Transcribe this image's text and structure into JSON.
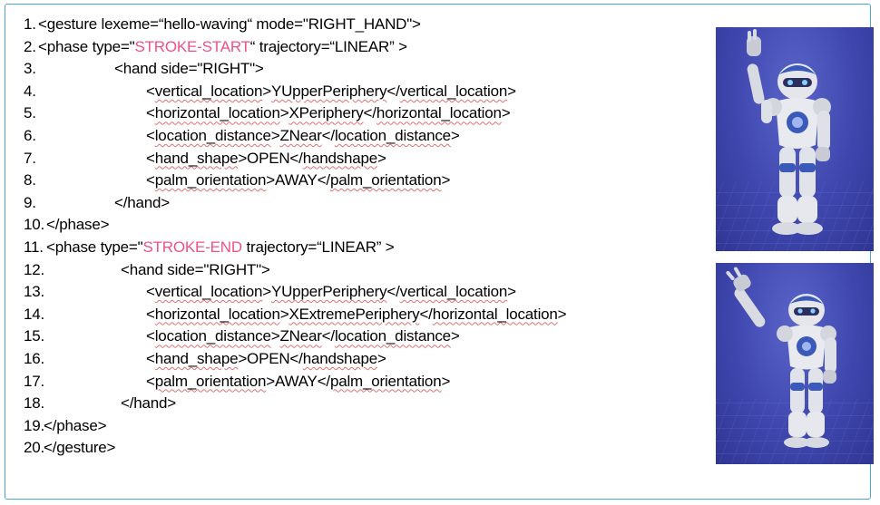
{
  "code_lines": [
    {
      "num": "1.",
      "indent": 0,
      "parts": [
        {
          "t": "<gesture lexeme=“hello-waving“ mode=\"RIGHT_HAND\">",
          "s": ""
        }
      ]
    },
    {
      "num": "2.",
      "indent": 0,
      "parts": [
        {
          "t": "<phase type=\"",
          "s": ""
        },
        {
          "t": "STROKE-START",
          "s": "red"
        },
        {
          "t": "“ trajectory=“LINEAR” >",
          "s": ""
        }
      ]
    },
    {
      "num": "3.",
      "indent": 100,
      "parts": [
        {
          "t": "<hand side=\"RIGHT\">",
          "s": ""
        }
      ]
    },
    {
      "num": "4.",
      "indent": 135,
      "parts": [
        {
          "t": "<",
          "s": ""
        },
        {
          "t": "vertical_location",
          "s": "sq"
        },
        {
          "t": ">",
          "s": ""
        },
        {
          "t": "YUpperPeriphery",
          "s": "sq"
        },
        {
          "t": "</",
          "s": ""
        },
        {
          "t": "vertical_location",
          "s": "sq"
        },
        {
          "t": ">",
          "s": ""
        }
      ]
    },
    {
      "num": "5.",
      "indent": 135,
      "parts": [
        {
          "t": "<",
          "s": ""
        },
        {
          "t": "horizontal_location",
          "s": "sq"
        },
        {
          "t": ">",
          "s": ""
        },
        {
          "t": "XPeriphery",
          "s": "sq"
        },
        {
          "t": "</",
          "s": ""
        },
        {
          "t": "horizontal_location",
          "s": "sq"
        },
        {
          "t": ">",
          "s": ""
        }
      ]
    },
    {
      "num": "6.",
      "indent": 135,
      "parts": [
        {
          "t": "<",
          "s": ""
        },
        {
          "t": "location_distance",
          "s": "sq"
        },
        {
          "t": ">",
          "s": ""
        },
        {
          "t": "ZNear",
          "s": "sq"
        },
        {
          "t": "</",
          "s": ""
        },
        {
          "t": "location_distance",
          "s": "sq"
        },
        {
          "t": ">",
          "s": ""
        }
      ]
    },
    {
      "num": "7.",
      "indent": 135,
      "parts": [
        {
          "t": "<",
          "s": ""
        },
        {
          "t": "hand_shape",
          "s": "sq"
        },
        {
          "t": ">OPEN</",
          "s": ""
        },
        {
          "t": "handshape",
          "s": "sq"
        },
        {
          "t": ">",
          "s": ""
        }
      ]
    },
    {
      "num": "8.",
      "indent": 135,
      "parts": [
        {
          "t": "<",
          "s": ""
        },
        {
          "t": "palm_orientation",
          "s": "sq"
        },
        {
          "t": ">AWAY</",
          "s": ""
        },
        {
          "t": "palm_orientation",
          "s": "sq"
        },
        {
          "t": ">",
          "s": ""
        }
      ]
    },
    {
      "num": "9.",
      "indent": 100,
      "parts": [
        {
          "t": "</hand>",
          "s": ""
        }
      ]
    },
    {
      "num": "10.",
      "indent": 0,
      "parts": [
        {
          "t": "</phase>",
          "s": ""
        }
      ]
    },
    {
      "num": "11.",
      "indent": 0,
      "parts": [
        {
          "t": "<phase type=\"",
          "s": ""
        },
        {
          "t": "STROKE-END",
          "s": "red"
        },
        {
          "t": " trajectory=“LINEAR” >",
          "s": ""
        }
      ]
    },
    {
      "num": "12.",
      "indent": 107,
      "parts": [
        {
          "t": "<hand side=\"RIGHT\">",
          "s": ""
        }
      ]
    },
    {
      "num": "13.",
      "indent": 135,
      "parts": [
        {
          "t": "<",
          "s": ""
        },
        {
          "t": "vertical_location",
          "s": "sq"
        },
        {
          "t": ">",
          "s": ""
        },
        {
          "t": "YUpperPeriphery",
          "s": "sq"
        },
        {
          "t": "</",
          "s": ""
        },
        {
          "t": "vertical_location",
          "s": "sq"
        },
        {
          "t": ">",
          "s": ""
        }
      ]
    },
    {
      "num": "14.",
      "indent": 135,
      "parts": [
        {
          "t": "<",
          "s": ""
        },
        {
          "t": "horizontal_location",
          "s": "sq"
        },
        {
          "t": ">",
          "s": ""
        },
        {
          "t": "XExtremePeriphery",
          "s": "sq"
        },
        {
          "t": "</",
          "s": ""
        },
        {
          "t": "horizontal_location",
          "s": "sq"
        },
        {
          "t": ">",
          "s": ""
        }
      ]
    },
    {
      "num": "15.",
      "indent": 135,
      "parts": [
        {
          "t": "<",
          "s": ""
        },
        {
          "t": "location_distance",
          "s": "sq"
        },
        {
          "t": ">",
          "s": ""
        },
        {
          "t": "ZNear",
          "s": "sq"
        },
        {
          "t": "</",
          "s": ""
        },
        {
          "t": "location_distance",
          "s": "sq"
        },
        {
          "t": ">",
          "s": ""
        }
      ]
    },
    {
      "num": "16.",
      "indent": 135,
      "parts": [
        {
          "t": "<",
          "s": ""
        },
        {
          "t": "hand_shape",
          "s": "sq"
        },
        {
          "t": ">OPEN</",
          "s": ""
        },
        {
          "t": "handshape",
          "s": "sq"
        },
        {
          "t": ">",
          "s": ""
        }
      ]
    },
    {
      "num": "17.",
      "indent": 135,
      "parts": [
        {
          "t": "<",
          "s": ""
        },
        {
          "t": "palm_orientation",
          "s": "sq"
        },
        {
          "t": ">AWAY</",
          "s": ""
        },
        {
          "t": "palm_orientation",
          "s": "sq"
        },
        {
          "t": ">",
          "s": ""
        }
      ]
    },
    {
      "num": "18.",
      "indent": 107,
      "parts": [
        {
          "t": "</hand>",
          "s": ""
        }
      ]
    },
    {
      "num": "19.",
      "indent": 0,
      "parts": [
        {
          "t": "</phase>",
          "s": ""
        }
      ]
    },
    {
      "num": "20.",
      "indent": 0,
      "parts": [
        {
          "t": "</gesture>",
          "s": ""
        }
      ]
    }
  ],
  "colors": {
    "frame_border": "#49a6cf",
    "keyword_red": "#f0508a",
    "spell_squiggle": "#e07070",
    "robot_background": "#3f47ae"
  },
  "images": [
    {
      "name": "robot-image-stroke-start",
      "depicts": "humanoid robot waving right hand"
    },
    {
      "name": "robot-image-stroke-end",
      "depicts": "humanoid robot waving right hand, extended"
    }
  ]
}
